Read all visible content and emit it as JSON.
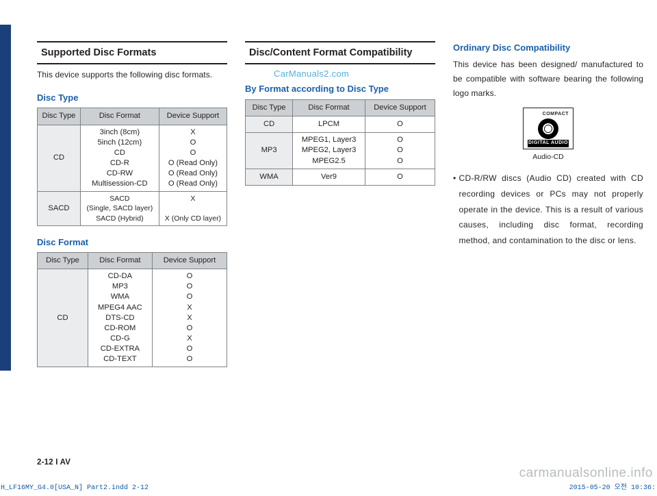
{
  "watermark": "CarManuals2.com",
  "col1": {
    "heading1": "Supported Disc Formats",
    "intro": "This device supports the following disc formats.",
    "sub_disc_type": "Disc Type",
    "table1": {
      "h1": "Disc Type",
      "h2": "Disc Format",
      "h3": "Device Support",
      "r1_type": "CD",
      "r1_fmt": "3inch (8cm)\n5inch (12cm)\nCD\nCD-R\nCD-RW\nMultisession-CD",
      "r1_sup": "X\nO\nO\nO (Read Only)\nO (Read Only)\nO (Read Only)",
      "r2_type": "SACD",
      "r2_fmt": "SACD\n(Single, SACD layer)\nSACD (Hybrid)",
      "r2_sup": "X\n\nX (Only CD layer)"
    },
    "sub_disc_format": "Disc Format",
    "table2": {
      "h1": "Disc Type",
      "h2": "Disc Format",
      "h3": "Device Support",
      "r1_type": "CD",
      "r1_fmt": "CD-DA\nMP3\nWMA\nMPEG4 AAC\nDTS-CD\nCD-ROM\nCD-G\nCD-EXTRA\nCD-TEXT",
      "r1_sup": "O\nO\nO\nX\nX\nO\nX\nO\nO"
    }
  },
  "col2": {
    "heading1": "Disc/Content Format Compatibility",
    "sub_by_format": "By Format according to Disc Type",
    "table3": {
      "h1": "Disc Type",
      "h2": "Disc Format",
      "h3": "Device Support",
      "r1_type": "CD",
      "r1_fmt": "LPCM",
      "r1_sup": "O",
      "r2_type": "MP3",
      "r2_fmt": "MPEG1, Layer3\nMPEG2, Layer3\nMPEG2.5",
      "r2_sup": "O\nO\nO",
      "r3_type": "WMA",
      "r3_fmt": "Ver9",
      "r3_sup": "O"
    }
  },
  "col3": {
    "sub_ordinary": "Ordinary Disc Compatibility",
    "p1": "This device has been designed/ manufactured to be compatible with software bearing the following logo marks.",
    "logo_top_left": "",
    "logo_top_right": "COMPACT",
    "logo_bottom": "DIGITAL AUDIO",
    "logo_caption": "Audio-CD",
    "bullet": "CD-R/RW discs (Audio CD) created with CD recording devices or PCs may not properly operate in the device. This is a result of various causes, including disc format, recording method, and contamination to the disc or lens."
  },
  "footer": {
    "pagenum": "2-12 I AV",
    "print_left": "H_LF16MY_G4.0[USA_N] Part2.indd   2-12",
    "print_right": "2015-05-20   오전 10:36:",
    "site": "carmanualsonline.info"
  }
}
